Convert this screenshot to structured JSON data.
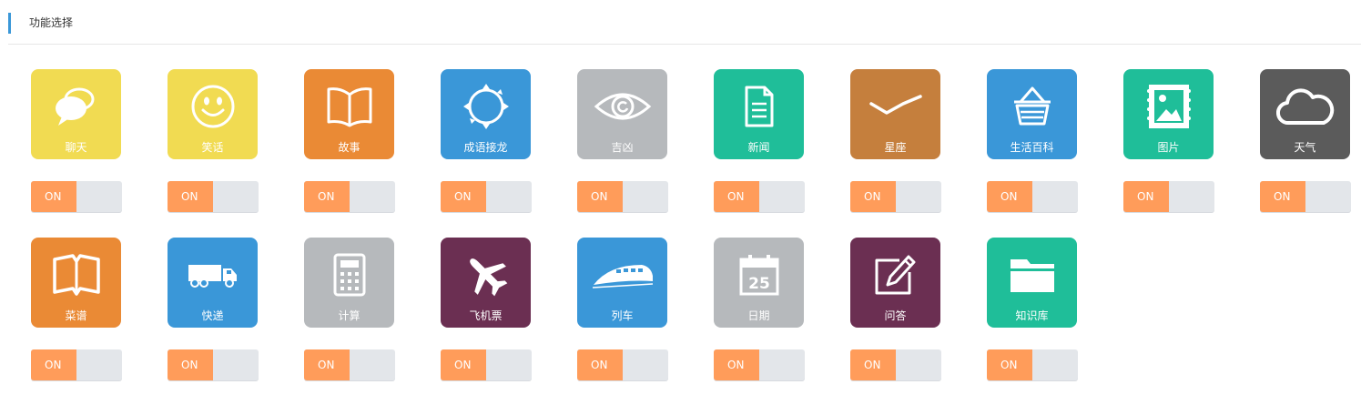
{
  "header": {
    "title": "功能选择"
  },
  "features": [
    {
      "label": "聊天",
      "toggle": "ON",
      "color": "#f1db52",
      "icon": "chat-bubbles-icon"
    },
    {
      "label": "笑话",
      "toggle": "ON",
      "color": "#f1db52",
      "icon": "smiley-icon"
    },
    {
      "label": "故事",
      "toggle": "ON",
      "color": "#ea8a35",
      "icon": "open-book-icon"
    },
    {
      "label": "成语接龙",
      "toggle": "ON",
      "color": "#3a97d8",
      "icon": "circle-arrows-icon"
    },
    {
      "label": "吉凶",
      "toggle": "ON",
      "color": "#b6b9bc",
      "icon": "eye-icon"
    },
    {
      "label": "新闻",
      "toggle": "ON",
      "color": "#1fbe99",
      "icon": "document-icon"
    },
    {
      "label": "星座",
      "toggle": "ON",
      "color": "#c57f3d",
      "icon": "zigzag-line-icon"
    },
    {
      "label": "生活百科",
      "toggle": "ON",
      "color": "#3a97d8",
      "icon": "basket-icon"
    },
    {
      "label": "图片",
      "toggle": "ON",
      "color": "#1fbe99",
      "icon": "picture-stamp-icon"
    },
    {
      "label": "天气",
      "toggle": "ON",
      "color": "#5b5b5b",
      "icon": "cloud-icon"
    },
    {
      "label": "菜谱",
      "toggle": "ON",
      "color": "#ea8a35",
      "icon": "book-outline-icon"
    },
    {
      "label": "快递",
      "toggle": "ON",
      "color": "#3a97d8",
      "icon": "truck-icon"
    },
    {
      "label": "计算",
      "toggle": "ON",
      "color": "#b6b9bc",
      "icon": "calculator-icon"
    },
    {
      "label": "飞机票",
      "toggle": "ON",
      "color": "#6b2f52",
      "icon": "airplane-icon"
    },
    {
      "label": "列车",
      "toggle": "ON",
      "color": "#3a97d8",
      "icon": "train-icon"
    },
    {
      "label": "日期",
      "toggle": "ON",
      "color": "#b6b9bc",
      "icon": "calendar-icon",
      "calendar_number": "25"
    },
    {
      "label": "问答",
      "toggle": "ON",
      "color": "#6b2f52",
      "icon": "edit-pencil-icon"
    },
    {
      "label": "知识库",
      "toggle": "ON",
      "color": "#1fbe99",
      "icon": "folder-icon"
    }
  ]
}
